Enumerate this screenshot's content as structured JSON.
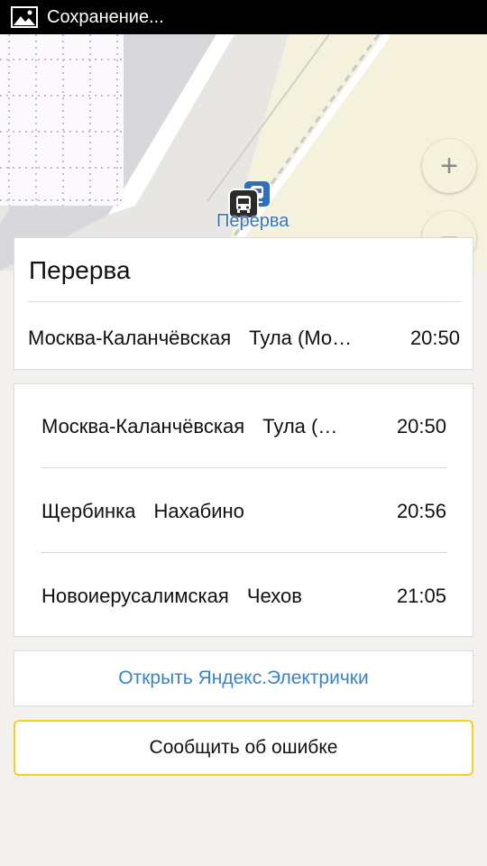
{
  "status_bar": {
    "text": "Сохранение...",
    "icon": "image-icon"
  },
  "map": {
    "station_label": "Перерва",
    "zoom_in_label": "+",
    "zoom_out_label": "−",
    "icons": [
      "bus-stop-icon",
      "train-station-icon"
    ]
  },
  "station": {
    "name": "Перерва",
    "departure": {
      "from": "Москва-Каланчёвская",
      "to": "Тула (Мо…",
      "time": "20:50"
    }
  },
  "departures": [
    {
      "from": "Москва-Каланчёвская",
      "to": "Тула (…",
      "time": "20:50"
    },
    {
      "from": "Щербинка",
      "to": "Нахабино",
      "time": "20:56"
    },
    {
      "from": "Новоиерусалимская",
      "to": "Чехов",
      "time": "21:05"
    }
  ],
  "actions": {
    "open_app": "Открыть Яндекс.Электрички",
    "report_error": "Сообщить об ошибке"
  },
  "colors": {
    "accent": "#3a83c9",
    "report_border": "#f5d21e",
    "map_park": "#f4f1dc"
  }
}
